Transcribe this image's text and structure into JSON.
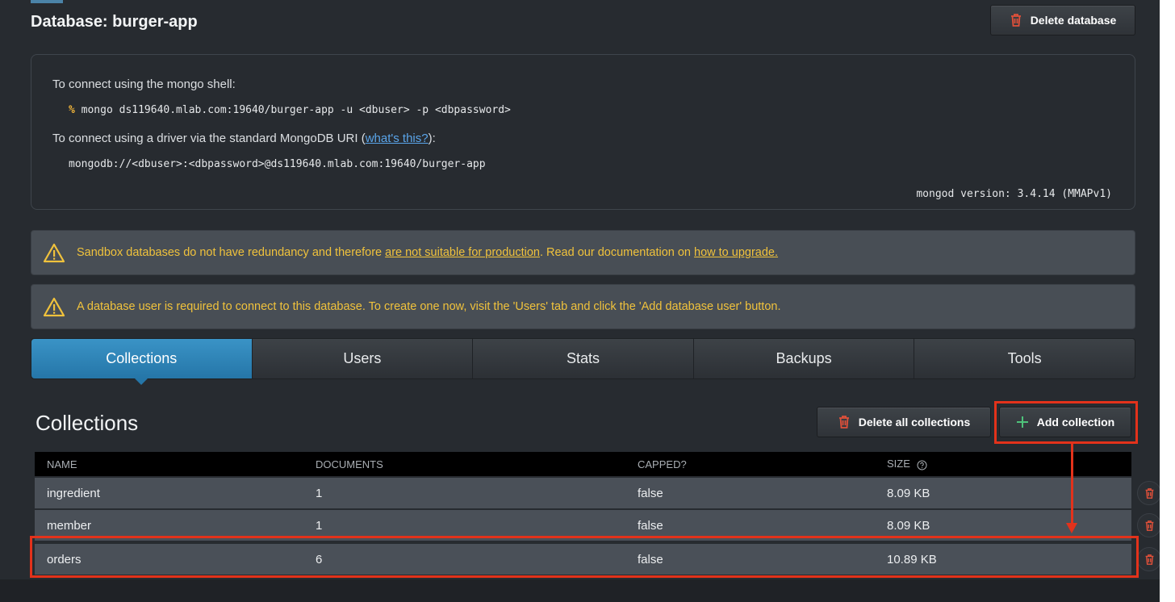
{
  "database": {
    "title": "Database: burger-app",
    "delete_label": "Delete database"
  },
  "connection": {
    "shell_intro": "To connect using the mongo shell:",
    "shell_prompt": "%",
    "shell_cmd": "mongo ds119640.mlab.com:19640/burger-app -u <dbuser> -p <dbpassword>",
    "driver_intro_before": "To connect using a driver via the standard MongoDB URI (",
    "driver_link": "what's this?",
    "driver_intro_after": "):",
    "uri": "mongodb://<dbuser>:<dbpassword>@ds119640.mlab.com:19640/burger-app",
    "version": "mongod version: 3.4.14 (MMAPv1)"
  },
  "alerts": [
    {
      "text_before": "Sandbox databases do not have redundancy and therefore ",
      "link1": "are not suitable for production",
      "text_mid": ". Read our documentation on ",
      "link2": "how to upgrade."
    },
    {
      "text": "A database user is required to connect to this database. To create one now, visit the 'Users' tab and click the 'Add database user' button."
    }
  ],
  "tabs": [
    {
      "label": "Collections",
      "active": true
    },
    {
      "label": "Users"
    },
    {
      "label": "Stats"
    },
    {
      "label": "Backups"
    },
    {
      "label": "Tools"
    }
  ],
  "collections": {
    "title": "Collections",
    "delete_all_label": "Delete all collections",
    "add_label": "Add collection",
    "columns": [
      "NAME",
      "DOCUMENTS",
      "CAPPED?",
      "SIZE"
    ],
    "rows": [
      {
        "name": "ingredient",
        "documents": "1",
        "capped": "false",
        "size": "8.09 KB"
      },
      {
        "name": "member",
        "documents": "1",
        "capped": "false",
        "size": "8.09 KB"
      },
      {
        "name": "orders",
        "documents": "6",
        "capped": "false",
        "size": "10.89 KB"
      }
    ]
  },
  "colors": {
    "accent": "#2f86bb",
    "warning": "#f0c23c",
    "delete_red": "#e0503a",
    "add_green": "#4ec27a",
    "highlight": "#e3321b"
  },
  "icons": {
    "trash": "trash-icon",
    "plus": "plus-icon",
    "warning": "warning-icon",
    "help": "help-icon"
  }
}
